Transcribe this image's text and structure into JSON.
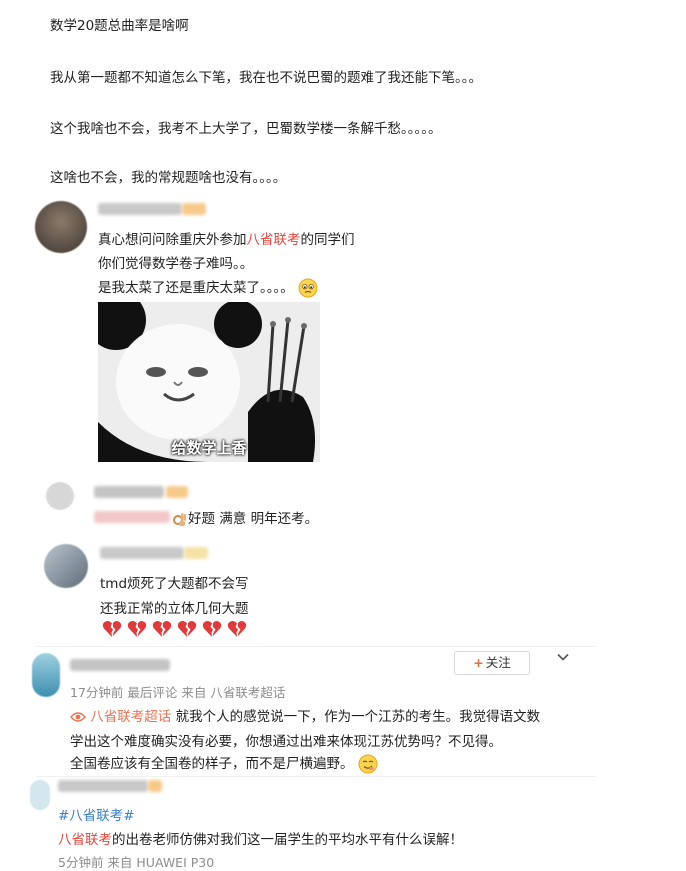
{
  "post": {
    "title": "数学20题总曲率是啥啊",
    "lines": [
      "我从第一题都不知道怎么下笔，我在也不说巴蜀的题难了我还能下笔。。。",
      "这个我啥也不会，我考不上大学了，巴蜀数学楼一条解千愁。。。。。",
      "这啥也不会，我的常规题啥也没有。。。。"
    ]
  },
  "comments": [
    {
      "line1_prefix": "真心想问问除重庆外参加",
      "line1_tag": "八省联考",
      "line1_suffix": "的同学们",
      "line2": "你们觉得数学卷子难吗。。",
      "line3": "是我太菜了还是重庆太菜了。。。。",
      "line3_emoji": "sad-face-icon",
      "meme_caption": "给数学上香"
    },
    {
      "text": "好题 满意 明年还考。",
      "emoji": "ok-hand-icon"
    },
    {
      "line1": "tmd烦死了大题都不会写",
      "line2": "还我正常的立体几何大题",
      "emoji_count": 6,
      "emoji": "broken-heart-icon"
    },
    {
      "follow_label": "关注",
      "meta": "17分钟前 最后评论 来自 八省联考超话",
      "topic_tag": "八省联考超话",
      "line1": "就我个人的感觉说一下，作为一个江苏的考生。我觉得语文数",
      "line2": "学出这个难度确实没有必要，你想通过出难来体现江苏优势吗？不见得。",
      "line3": "全国卷应该有全国卷的样子，而不是尸横遍野。",
      "line3_emoji": "smirk-face-icon"
    },
    {
      "hashtag": "#八省联考#",
      "tag": "八省联考",
      "text_suffix": "的出卷老师仿佛对我们这一届学生的平均水平有什么误解！",
      "meta": "5分钟前 来自 HUAWEI P30"
    }
  ],
  "colors": {
    "accent": "#eb7350",
    "link": "#3b7ec7",
    "tag_red": "#e0463b"
  }
}
